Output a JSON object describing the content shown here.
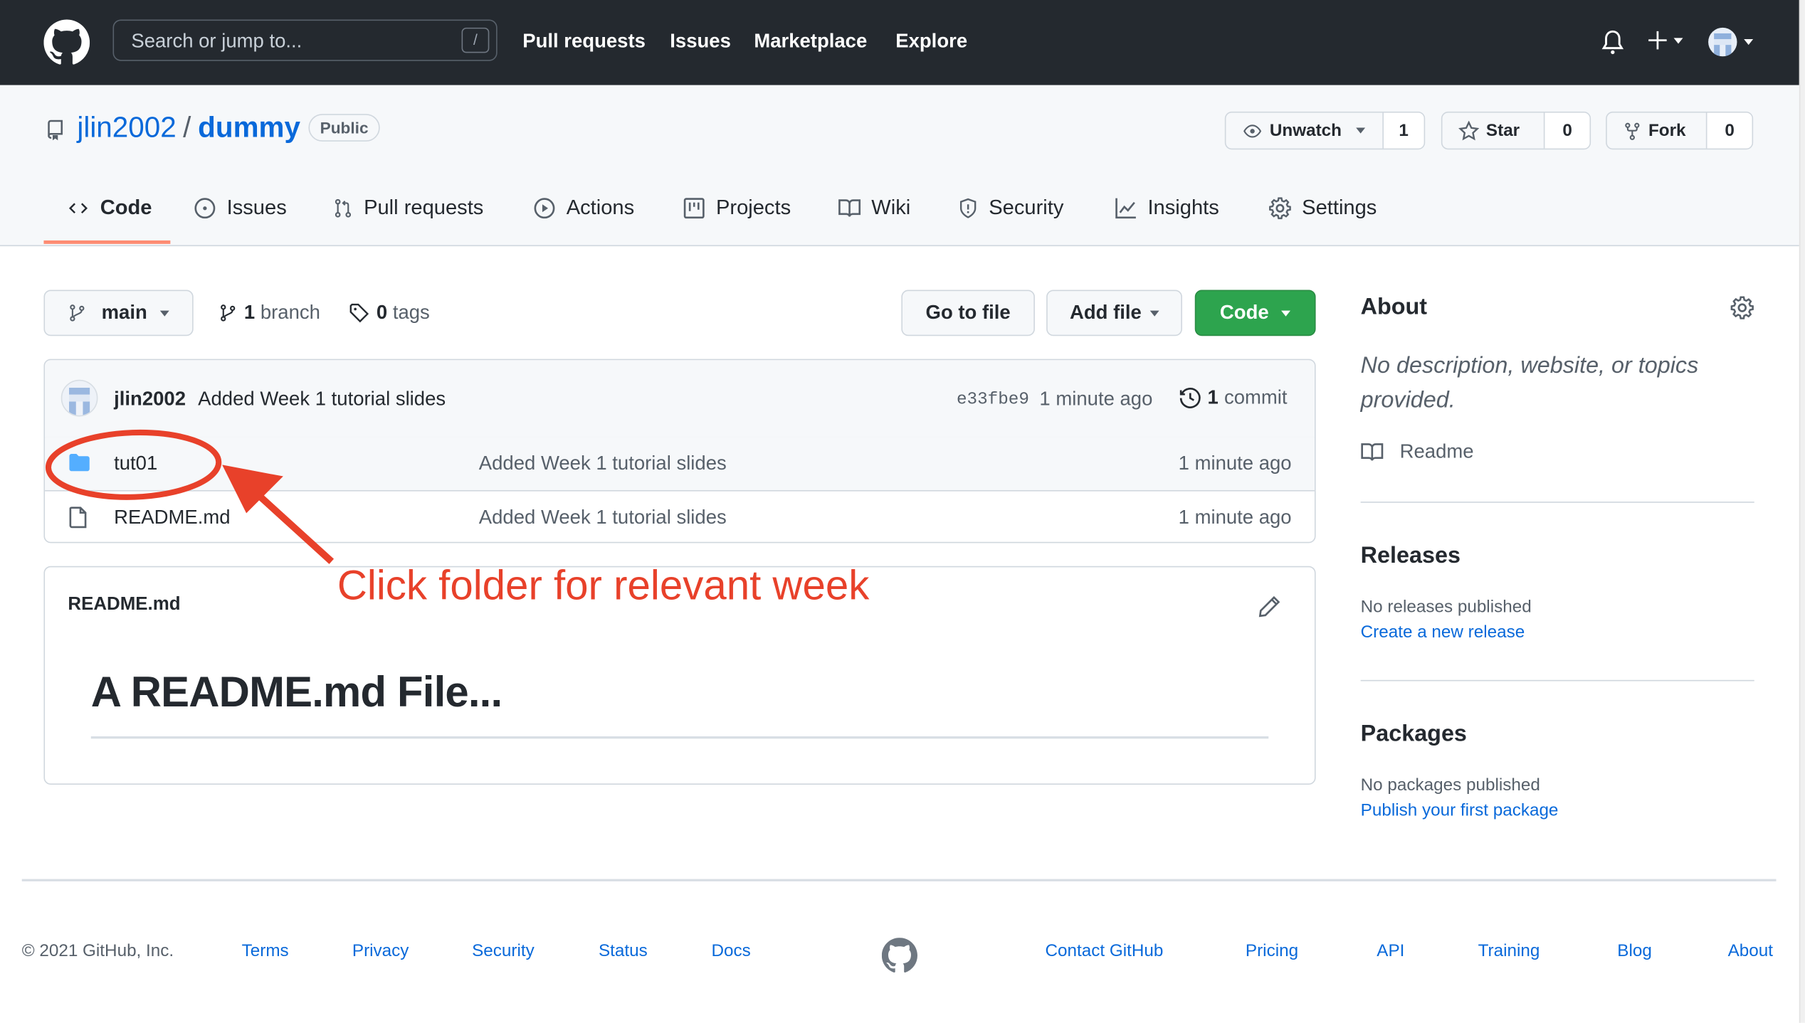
{
  "header": {
    "search_placeholder": "Search or jump to...",
    "search_shortcut": "/",
    "nav": [
      "Pull requests",
      "Issues",
      "Marketplace",
      "Explore"
    ],
    "icons": [
      "github-logo-icon",
      "bell-icon",
      "plus-icon",
      "avatar"
    ]
  },
  "repo": {
    "owner": "jlin2002",
    "separator": "/",
    "name": "dummy",
    "visibility": "Public",
    "watch": {
      "label": "Unwatch",
      "count": "1"
    },
    "star": {
      "label": "Star",
      "count": "0"
    },
    "fork": {
      "label": "Fork",
      "count": "0"
    }
  },
  "tabs": [
    {
      "label": "Code",
      "icon": "code-icon",
      "active": true
    },
    {
      "label": "Issues",
      "icon": "issue-icon"
    },
    {
      "label": "Pull requests",
      "icon": "pull-request-icon"
    },
    {
      "label": "Actions",
      "icon": "play-icon"
    },
    {
      "label": "Projects",
      "icon": "project-icon"
    },
    {
      "label": "Wiki",
      "icon": "book-icon"
    },
    {
      "label": "Security",
      "icon": "shield-icon"
    },
    {
      "label": "Insights",
      "icon": "graph-icon"
    },
    {
      "label": "Settings",
      "icon": "gear-icon"
    }
  ],
  "toolbar": {
    "branch": "main",
    "branch_count": "1",
    "branch_label": "branch",
    "tag_count": "0",
    "tag_label": "tags",
    "go_to_file": "Go to file",
    "add_file": "Add file",
    "code": "Code"
  },
  "latest_commit": {
    "author": "jlin2002",
    "message": "Added Week 1 tutorial slides",
    "sha": "e33fbe9",
    "time": "1 minute ago",
    "commit_count": "1",
    "commit_label": "commit"
  },
  "files": [
    {
      "name": "tut01",
      "type": "folder",
      "message": "Added Week 1 tutorial slides",
      "time": "1 minute ago"
    },
    {
      "name": "README.md",
      "type": "file",
      "message": "Added Week 1 tutorial slides",
      "time": "1 minute ago"
    }
  ],
  "readme": {
    "title": "README.md",
    "heading": "A README.md File..."
  },
  "sidebar": {
    "about_title": "About",
    "about_desc": "No description, website, or topics provided.",
    "readme_link": "Readme",
    "releases_title": "Releases",
    "releases_text": "No releases published",
    "releases_link": "Create a new release",
    "packages_title": "Packages",
    "packages_text": "No packages published",
    "packages_link": "Publish your first package"
  },
  "footer": {
    "copyright": "© 2021 GitHub, Inc.",
    "left_links": [
      "Terms",
      "Privacy",
      "Security",
      "Status",
      "Docs"
    ],
    "right_links": [
      "Contact GitHub",
      "Pricing",
      "API",
      "Training",
      "Blog",
      "About"
    ]
  },
  "annotation": {
    "text": "Click folder for relevant week",
    "color": "#e8412a"
  },
  "colors": {
    "header_bg": "#24292f",
    "link": "#0969da",
    "code_button": "#2da44e",
    "active_tab": "#fd8c73",
    "folder": "#54aeff"
  }
}
